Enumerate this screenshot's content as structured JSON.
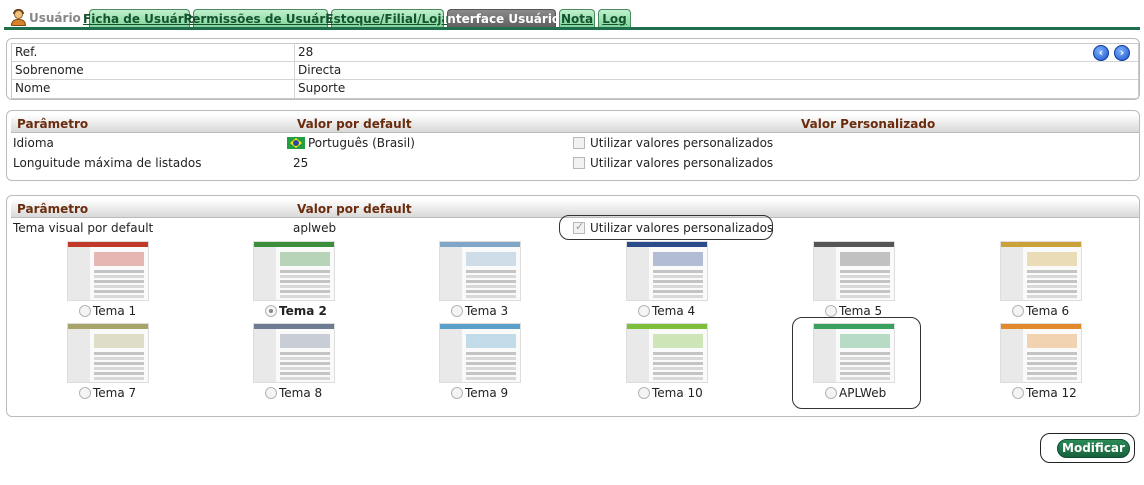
{
  "header": {
    "module_label": "Usuário",
    "tabs": [
      {
        "label": "Ficha de Usuário",
        "active": false
      },
      {
        "label": "Permissões de Usuário",
        "active": false
      },
      {
        "label": "Estoque/Filial/Loja",
        "active": false
      },
      {
        "label": "Interface Usuário",
        "active": true
      },
      {
        "label": "Nota",
        "active": false
      },
      {
        "label": "Log",
        "active": false
      }
    ]
  },
  "record": {
    "rows": [
      {
        "label": "Ref.",
        "value": "28"
      },
      {
        "label": "Sobrenome",
        "value": "Directa"
      },
      {
        "label": "Nome",
        "value": "Suporte"
      }
    ],
    "nav_prev_icon": "arrow-left-icon",
    "nav_next_icon": "arrow-right-icon"
  },
  "params": {
    "headers": [
      "Parâmetro",
      "Valor por default",
      "Valor Personalizado"
    ],
    "rows": [
      {
        "param": "Idioma",
        "default": "Português (Brasil)",
        "custom_label": "Utilizar valores personalizados",
        "checked": false
      },
      {
        "param": "Longuitude máxima de listados",
        "default": "25",
        "custom_label": "Utilizar valores personalizados",
        "checked": false
      }
    ]
  },
  "theme_section": {
    "headers": [
      "Parâmetro",
      "Valor por default"
    ],
    "row": {
      "param": "Tema visual por default",
      "default": "aplweb",
      "custom_label": "Utilizar valores personalizados",
      "checked": true
    },
    "themes": [
      {
        "label": "Tema 1",
        "selected": false,
        "accent": "#c0392b"
      },
      {
        "label": "Tema 2",
        "selected": true,
        "accent": "#3c8d3c"
      },
      {
        "label": "Tema 3",
        "selected": false,
        "accent": "#7fa6c7"
      },
      {
        "label": "Tema 4",
        "selected": false,
        "accent": "#2a4a8a"
      },
      {
        "label": "Tema 5",
        "selected": false,
        "accent": "#555555"
      },
      {
        "label": "Tema 6",
        "selected": false,
        "accent": "#c9a23a"
      },
      {
        "label": "Tema 7",
        "selected": false,
        "accent": "#a8a56a"
      },
      {
        "label": "Tema 8",
        "selected": false,
        "accent": "#6d7b93"
      },
      {
        "label": "Tema 9",
        "selected": false,
        "accent": "#5aa0c8"
      },
      {
        "label": "Tema 10",
        "selected": false,
        "accent": "#7cbf3a"
      },
      {
        "label": "APLWeb",
        "selected": false,
        "accent": "#3aa060"
      },
      {
        "label": "Tema 12",
        "selected": false,
        "accent": "#e08a2c"
      }
    ]
  },
  "actions": {
    "submit_label": "Modificar"
  },
  "colors": {
    "brand": "#1f6e4c",
    "header_text": "#6b2c0d"
  }
}
